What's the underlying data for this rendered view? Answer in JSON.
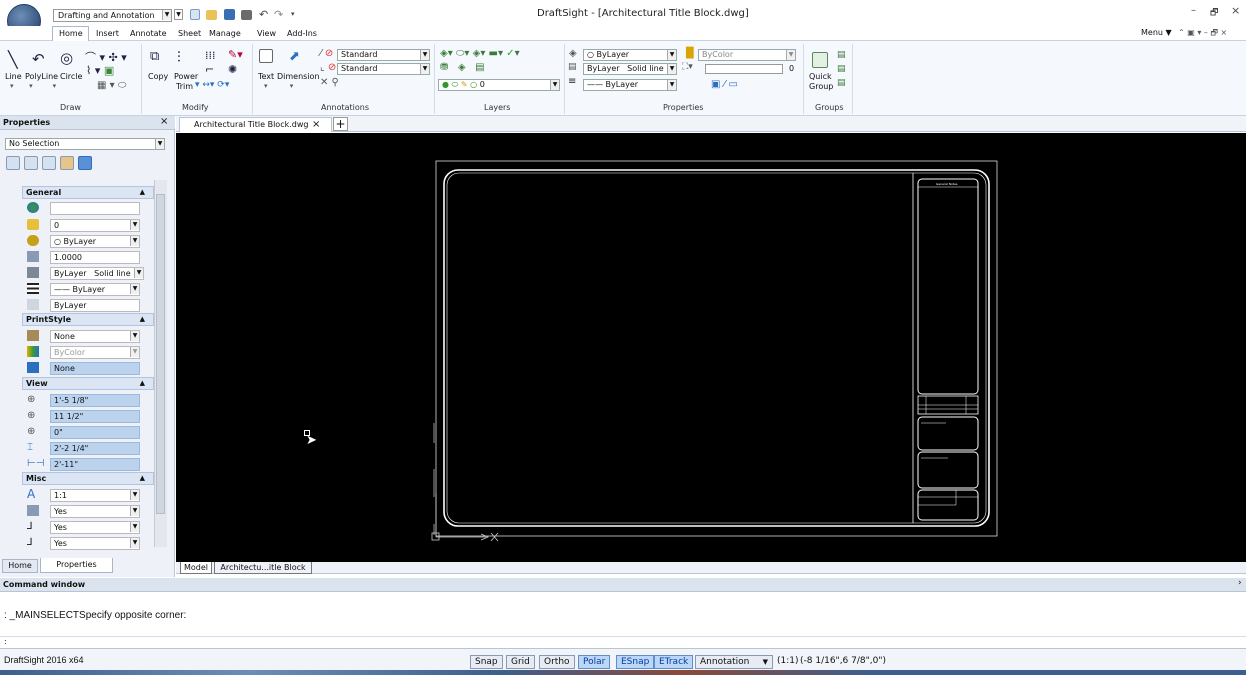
{
  "window": {
    "title": "DraftSight - [Architectural Title Block.dwg]",
    "menu_label": "Menu ▼"
  },
  "quick_access": {
    "workspace": "Drafting and Annotation"
  },
  "ribbon": {
    "tabs": [
      "Home",
      "Insert",
      "Annotate",
      "Sheet",
      "Manage",
      "View",
      "Add-Ins"
    ],
    "active_tab": "Home",
    "draw": {
      "title": "Draw",
      "line": "Line",
      "polyline": "PolyLine",
      "circle": "Circle"
    },
    "modify": {
      "title": "Modify",
      "copy": "Copy",
      "power": "Power",
      "trim": "Trim"
    },
    "annotations": {
      "title": "Annotations",
      "text": "Text",
      "dimension": "Dimension",
      "style1": "Standard",
      "style2": "Standard"
    },
    "layers": {
      "title": "Layers",
      "layer_value": "0"
    },
    "properties": {
      "title": "Properties",
      "color": "ByLayer",
      "linestyle_a": "ByLayer",
      "linestyle_b": "Solid line",
      "lineweight": "ByLayer",
      "print_color": "ByColor",
      "transparency": "0"
    },
    "groups": {
      "title": "Groups",
      "quick_group": "Quick Group"
    }
  },
  "properties_panel": {
    "title": "Properties",
    "close": "×",
    "selection": "No Selection",
    "general": {
      "title": "General",
      "color": "",
      "layer": "0",
      "linecolor": "ByLayer",
      "linescale": "1.0000",
      "linestyle_a": "ByLayer",
      "linestyle_b": "Solid line",
      "lineweight": "ByLayer",
      "transparency": "ByLayer"
    },
    "printstyle": {
      "title": "PrintStyle",
      "style": "None",
      "color": "ByColor",
      "table": "None"
    },
    "view": {
      "title": "View",
      "center_x": "1'-5 1/8\"",
      "center_y": "11 1/2\"",
      "center_z": "0\"",
      "height": "2'-2 1/4\"",
      "width": "2'-11\""
    },
    "misc": {
      "title": "Misc",
      "annotation_scale": "1:1",
      "ucs_icon_on": "Yes",
      "ucs_at_origin": "Yes",
      "ucs_per_viewport": "Yes"
    },
    "bottom_tabs": [
      "Home",
      "Properties"
    ]
  },
  "document": {
    "tab_label": "Architectural Title Block.dwg",
    "tab_close": "×",
    "add_tab": "+",
    "sheet_tabs": [
      "Model",
      "Architectu...itle Block"
    ],
    "titleblock": {
      "header": "General Notes",
      "stamp": "Firm Name"
    }
  },
  "command_window": {
    "title": "Command window",
    "line1": ": _MAINSELECTSpecify opposite corner:",
    "prompt": ":"
  },
  "status_bar": {
    "app": "DraftSight 2016 x64",
    "buttons": [
      "Snap",
      "Grid",
      "Ortho",
      "Polar",
      "ESnap",
      "ETrack"
    ],
    "active": [
      "Polar",
      "ESnap",
      "ETrack"
    ],
    "annotation": "Annotation",
    "scale": "(1:1)",
    "coords": "(-8 1/16\",6 7/8\",0\")"
  }
}
